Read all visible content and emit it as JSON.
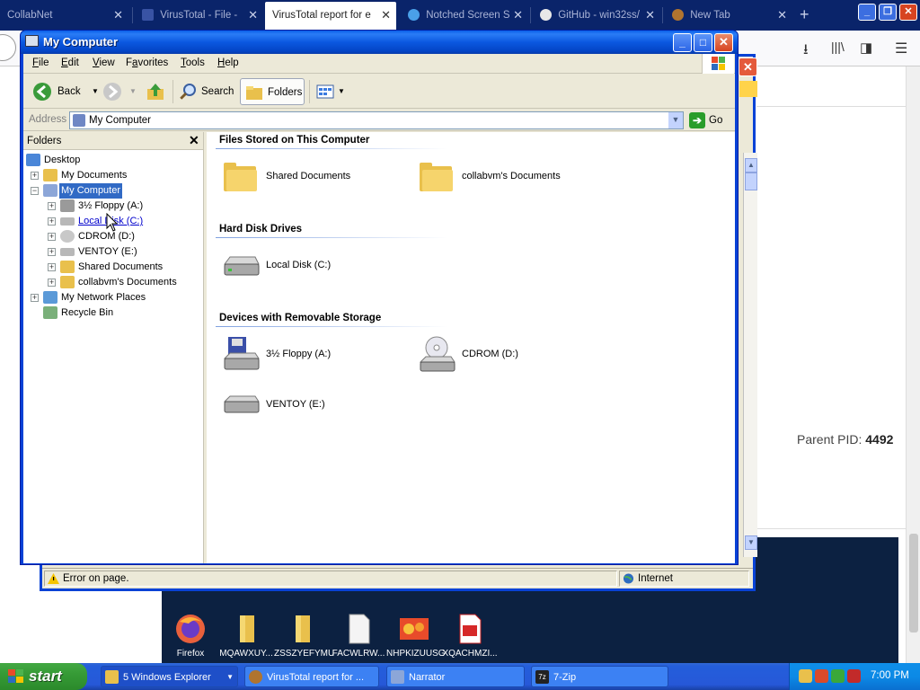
{
  "browser": {
    "tabs": [
      {
        "label": "CollabNet"
      },
      {
        "label": "VirusTotal - File -"
      },
      {
        "label": "VirusTotal report for e"
      },
      {
        "label": "Notched Screen S"
      },
      {
        "label": "GitHub - win32ss/"
      },
      {
        "label": "New Tab"
      }
    ],
    "new_tab_symbol": "+",
    "close_symbol": "✕"
  },
  "webpage": {
    "parent_pid_label": "Parent PID:",
    "parent_pid_value": "4492"
  },
  "ie_status": {
    "message": "Error on page.",
    "zone": "Internet"
  },
  "explorer": {
    "title": "My Computer",
    "menu": [
      {
        "pre": "",
        "key": "F",
        "post": "ile"
      },
      {
        "pre": "",
        "key": "E",
        "post": "dit"
      },
      {
        "pre": "",
        "key": "V",
        "post": "iew"
      },
      {
        "pre": "F",
        "key": "a",
        "post": "vorites"
      },
      {
        "pre": "",
        "key": "T",
        "post": "ools"
      },
      {
        "pre": "",
        "key": "H",
        "post": "elp"
      }
    ],
    "toolbar": {
      "back": "Back",
      "search": "Search",
      "folders": "Folders"
    },
    "address": {
      "label": "Address",
      "value": "My Computer",
      "go": "Go"
    },
    "folders_pane": {
      "title": "Folders",
      "close": "✕",
      "tree": [
        {
          "label": "Desktop"
        },
        {
          "label": "My Documents"
        },
        {
          "label": "My Computer"
        },
        {
          "label": "3½ Floppy (A:)"
        },
        {
          "label": "Local Disk (C:)"
        },
        {
          "label": "CDROM (D:)"
        },
        {
          "label": "VENTOY (E:)"
        },
        {
          "label": "Shared Documents"
        },
        {
          "label": "collabvm's Documents"
        },
        {
          "label": "My Network Places"
        },
        {
          "label": "Recycle Bin"
        }
      ]
    },
    "groups": [
      {
        "title": "Files Stored on This Computer",
        "items": [
          {
            "label": "Shared Documents"
          },
          {
            "label": "collabvm's Documents"
          }
        ]
      },
      {
        "title": "Hard Disk Drives",
        "items": [
          {
            "label": "Local Disk (C:)"
          }
        ]
      },
      {
        "title": "Devices with Removable Storage",
        "items": [
          {
            "label": "3½ Floppy (A:)"
          },
          {
            "label": "CDROM (D:)"
          },
          {
            "label": "VENTOY (E:)"
          }
        ]
      }
    ]
  },
  "desktop_icons": [
    {
      "label": "Firefox"
    },
    {
      "label": "MQAWXUY..."
    },
    {
      "label": "ZSSZYEFYMU"
    },
    {
      "label": "FACWLRW..."
    },
    {
      "label": "NHPKIZUUSG"
    },
    {
      "label": "XQACHMZI..."
    }
  ],
  "taskbar": {
    "start": "start",
    "tasks": [
      {
        "label": "5 Windows Explorer"
      },
      {
        "label": "VirusTotal report for ..."
      },
      {
        "label": "Narrator"
      },
      {
        "label": "7-Zip"
      }
    ],
    "clock": "7:00 PM"
  }
}
